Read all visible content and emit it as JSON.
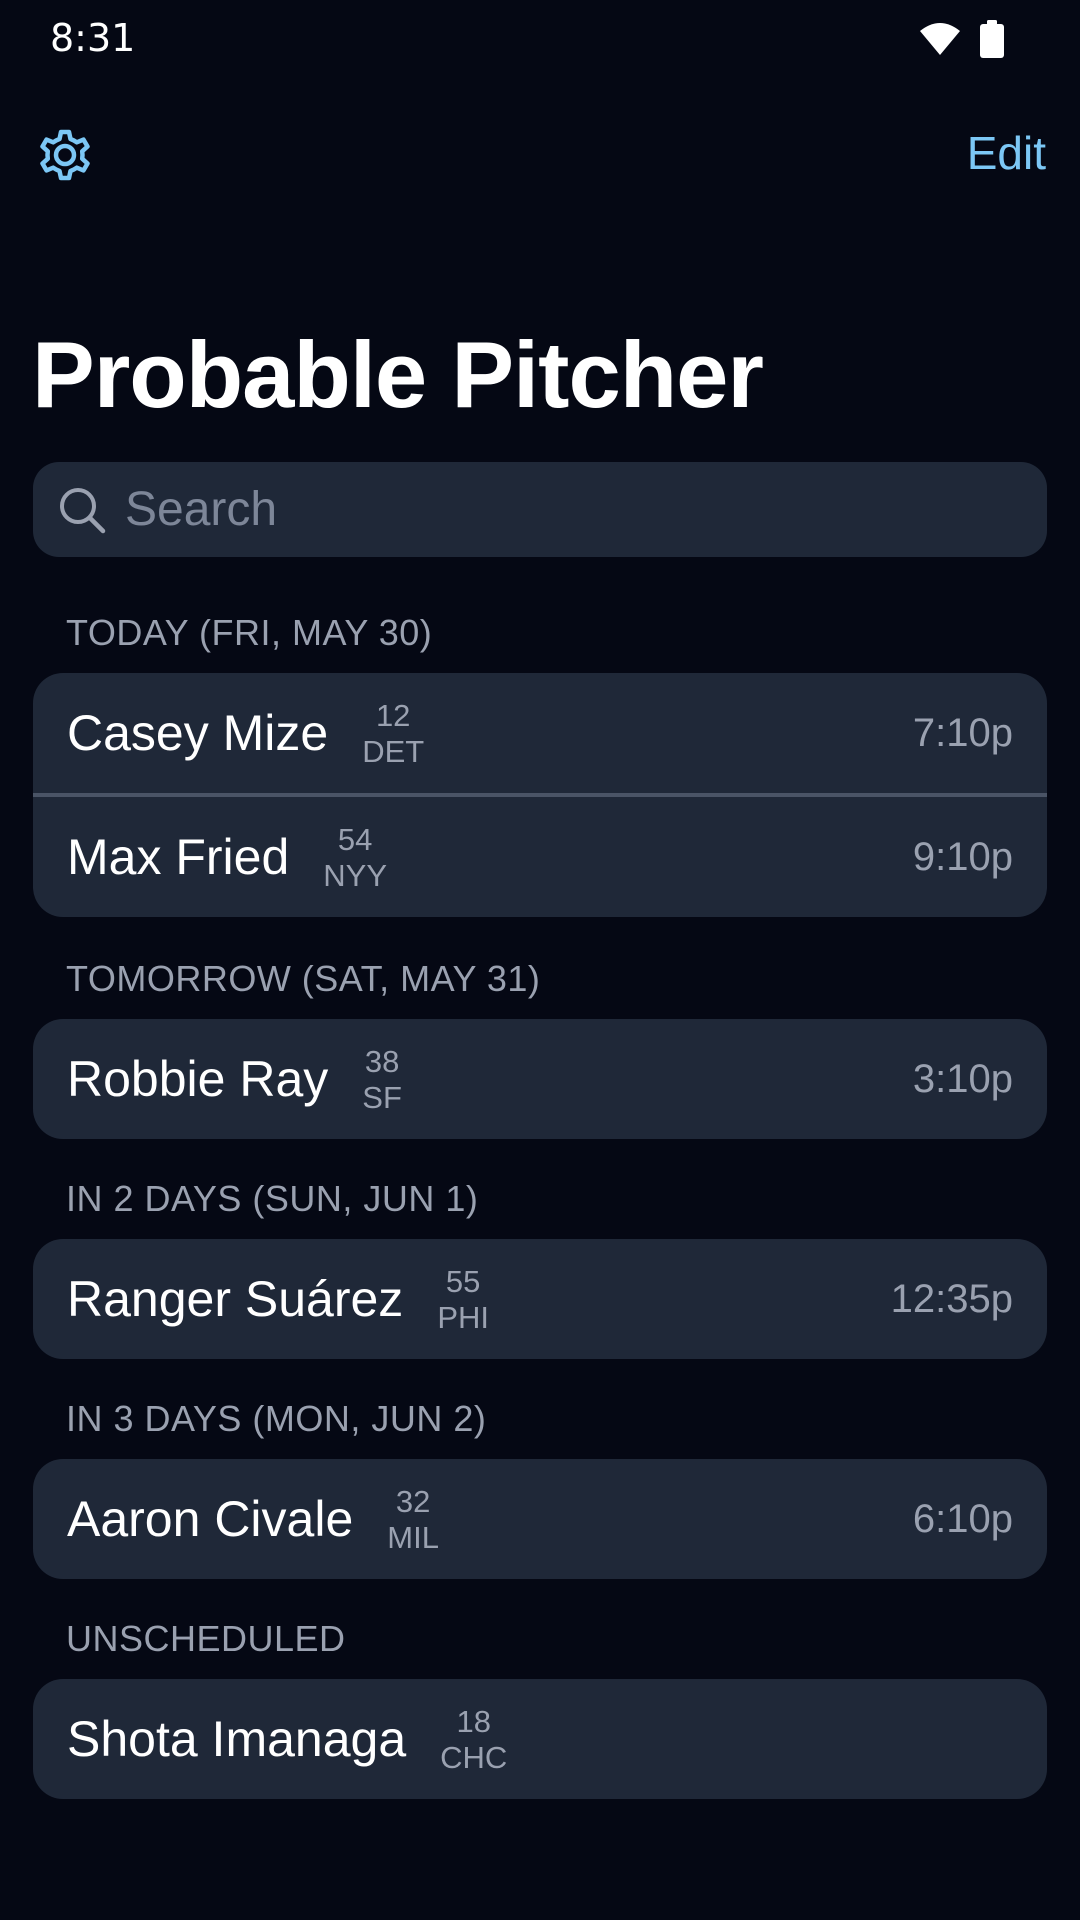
{
  "status_bar": {
    "time": "8:31"
  },
  "nav": {
    "edit_label": "Edit",
    "settings_icon": "gear-icon"
  },
  "title": "Probable Pitcher",
  "search": {
    "placeholder": "Search",
    "value": ""
  },
  "colors": {
    "background": "#050814",
    "card": "#1f2838",
    "accent": "#7cc7f5",
    "secondary_text": "#9aa1b0"
  },
  "sections": [
    {
      "header": "TODAY (FRI, MAY 30)",
      "rows": [
        {
          "name": "Casey Mize",
          "number": "12",
          "team": "DET",
          "time": "7:10p"
        },
        {
          "name": "Max Fried",
          "number": "54",
          "team": "NYY",
          "time": "9:10p"
        }
      ]
    },
    {
      "header": "TOMORROW (SAT, MAY 31)",
      "rows": [
        {
          "name": "Robbie Ray",
          "number": "38",
          "team": "SF",
          "time": "3:10p"
        }
      ]
    },
    {
      "header": "IN 2 DAYS (SUN, JUN 1)",
      "rows": [
        {
          "name": "Ranger Suárez",
          "number": "55",
          "team": "PHI",
          "time": "12:35p"
        }
      ]
    },
    {
      "header": "IN 3 DAYS (MON, JUN 2)",
      "rows": [
        {
          "name": "Aaron Civale",
          "number": "32",
          "team": "MIL",
          "time": "6:10p"
        }
      ]
    },
    {
      "header": "UNSCHEDULED",
      "rows": [
        {
          "name": "Shota Imanaga",
          "number": "18",
          "team": "CHC",
          "time": ""
        }
      ]
    }
  ]
}
